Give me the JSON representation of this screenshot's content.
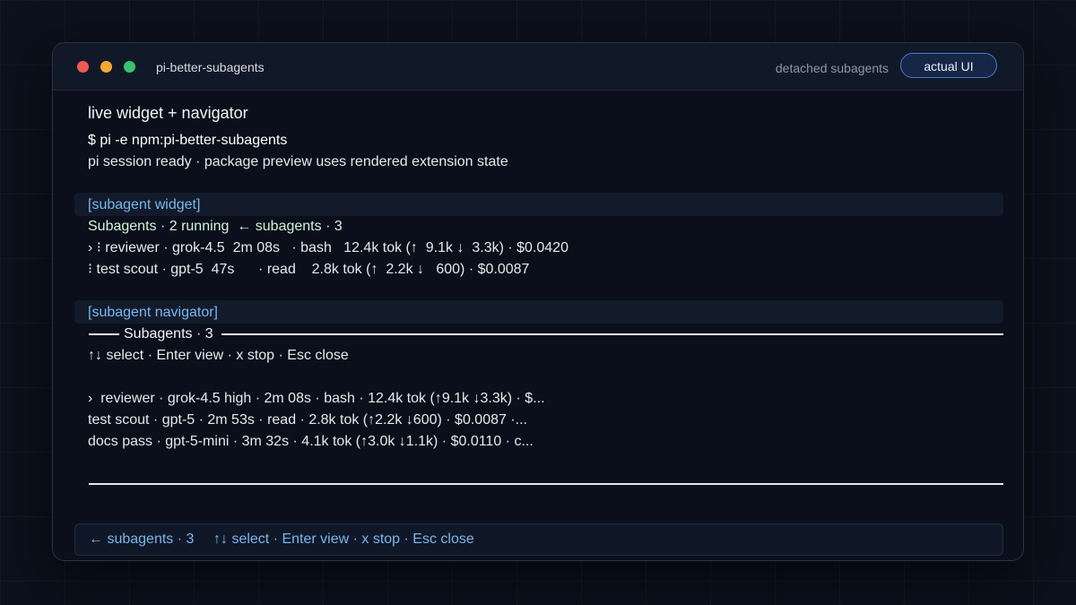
{
  "window": {
    "title": "pi-better-subagents",
    "subtitle": "detached subagents",
    "badge": "actual UI"
  },
  "terminal": {
    "heading": "live widget + navigator",
    "command": "$ pi -e npm:pi-better-subagents",
    "status": "pi session ready · package preview uses rendered extension state",
    "widget": {
      "tag": "[subagent widget]",
      "summary": "Subagents · 2 running  ← subagents · 3",
      "rows": [
        "› ⁝ reviewer · grok-4.5  2m 08s   · bash   12.4k tok (↑  9.1k ↓  3.3k) · $0.0420",
        "⁝ test scout · gpt-5  47s      · read    2.8k tok (↑  2.2k ↓   600) · $0.0087"
      ]
    },
    "navigator": {
      "tag": "[subagent navigator]",
      "title": "Subagents · 3",
      "hint": "↑↓ select · Enter view · x stop · Esc close",
      "rows": [
        "›  reviewer · grok-4.5 high · 2m 08s · bash · 12.4k tok (↑9.1k ↓3.3k) · $...",
        "test scout · gpt-5 · 2m 53s · read · 2.8k tok (↑2.2k ↓600) · $0.0087 ·...",
        "docs pass · gpt-5-mini · 3m 32s · 4.1k tok (↑3.0k ↓1.1k) · $0.0110 · c..."
      ]
    }
  },
  "footer": {
    "left": "← subagents · 3",
    "right": "↑↓ select · Enter view · x stop · Esc close"
  },
  "colors": {
    "accent": "#78b8ef",
    "running": "#d4f3d9",
    "close": "#ee5a52",
    "minimize": "#f4a832",
    "maximize": "#39c26a"
  }
}
